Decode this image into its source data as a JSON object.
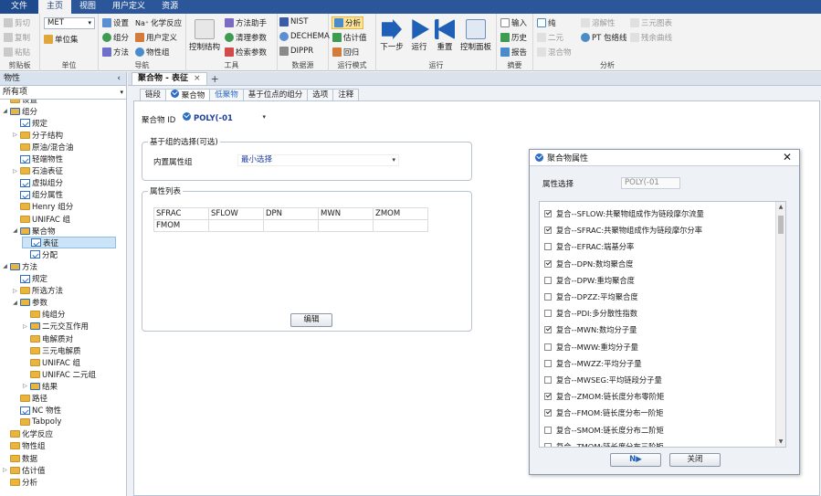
{
  "menu": {
    "file": "文件",
    "tabs": [
      "主页",
      "视图",
      "用户定义",
      "资源"
    ]
  },
  "ribbon": {
    "clipboard": {
      "label": "剪贴板",
      "cut": "剪切",
      "copy": "复制",
      "paste": "粘贴"
    },
    "unit": {
      "label": "单位",
      "set": "MET",
      "unitset": "单位集"
    },
    "nav": {
      "label": "导航",
      "settings": "设置",
      "components": "组分",
      "methods": "方法",
      "chem": "化学反应",
      "custom": "用户定义",
      "property_group": "物性组"
    },
    "tools": {
      "label": "工具",
      "control": "控制结构",
      "method_assist": "方法助手",
      "clean": "清理参数",
      "check": "检索参数"
    },
    "datasource": {
      "label": "数据源",
      "nist": "NIST",
      "dechema": "DECHEMA",
      "dippr": "DIPPR"
    },
    "runmode": {
      "label": "运行模式",
      "analysis": "分析",
      "estimate": "估计值",
      "regress": "回归"
    },
    "run": {
      "label": "运行",
      "next": "下一步",
      "run": "运行",
      "reset": "重置",
      "panel": "控制面板"
    },
    "summary": {
      "label": "摘要",
      "input": "输入",
      "history": "历史",
      "report": "报告"
    },
    "analysis": {
      "label": "分析",
      "pure": "纯",
      "binary": "二元",
      "mixture": "混合物",
      "residue": "溶解性",
      "pt": "PT 包络线",
      "ternary": "三元图表",
      "precip": "残余曲线"
    }
  },
  "left": {
    "title": "物性",
    "filter": "所有项",
    "tree": [
      {
        "label": "设置",
        "indent": 0,
        "icon": "folder",
        "exp": ""
      },
      {
        "label": "组分",
        "indent": 0,
        "icon": "folderb",
        "exp": "◢"
      },
      {
        "label": "规定",
        "indent": 1,
        "icon": "check",
        "exp": ""
      },
      {
        "label": "分子结构",
        "indent": 1,
        "icon": "folder",
        "exp": "▷"
      },
      {
        "label": "原油/混合油",
        "indent": 1,
        "icon": "folder",
        "exp": ""
      },
      {
        "label": "轻端物性",
        "indent": 1,
        "icon": "check",
        "exp": ""
      },
      {
        "label": "石油表征",
        "indent": 1,
        "icon": "folder",
        "exp": "▷"
      },
      {
        "label": "虚拟组分",
        "indent": 1,
        "icon": "check",
        "exp": ""
      },
      {
        "label": "组分属性",
        "indent": 1,
        "icon": "check",
        "exp": ""
      },
      {
        "label": "Henry 组分",
        "indent": 1,
        "icon": "folder",
        "exp": ""
      },
      {
        "label": "UNIFAC 组",
        "indent": 1,
        "icon": "folder",
        "exp": ""
      },
      {
        "label": "聚合物",
        "indent": 1,
        "icon": "folderb",
        "exp": "◢"
      },
      {
        "label": "表征",
        "indent": 2,
        "icon": "check",
        "exp": "",
        "sel": true
      },
      {
        "label": "分配",
        "indent": 2,
        "icon": "check",
        "exp": ""
      },
      {
        "label": "方法",
        "indent": 0,
        "icon": "folderb",
        "exp": "◢"
      },
      {
        "label": "规定",
        "indent": 1,
        "icon": "check",
        "exp": ""
      },
      {
        "label": "所选方法",
        "indent": 1,
        "icon": "folder",
        "exp": "▷"
      },
      {
        "label": "参数",
        "indent": 1,
        "icon": "folderb",
        "exp": "◢"
      },
      {
        "label": "纯组分",
        "indent": 2,
        "icon": "folder",
        "exp": ""
      },
      {
        "label": "二元交互作用",
        "indent": 2,
        "icon": "folderb",
        "exp": "▷"
      },
      {
        "label": "电解质对",
        "indent": 2,
        "icon": "folder",
        "exp": ""
      },
      {
        "label": "三元电解质",
        "indent": 2,
        "icon": "folder",
        "exp": ""
      },
      {
        "label": "UNIFAC 组",
        "indent": 2,
        "icon": "folder",
        "exp": ""
      },
      {
        "label": "UNIFAC 二元组",
        "indent": 2,
        "icon": "folder",
        "exp": ""
      },
      {
        "label": "结果",
        "indent": 2,
        "icon": "folderb",
        "exp": "▷"
      },
      {
        "label": "路径",
        "indent": 1,
        "icon": "folder",
        "exp": ""
      },
      {
        "label": "NC 物性",
        "indent": 1,
        "icon": "check",
        "exp": ""
      },
      {
        "label": "Tabpoly",
        "indent": 1,
        "icon": "folder",
        "exp": ""
      },
      {
        "label": "化学反应",
        "indent": 0,
        "icon": "folder",
        "exp": ""
      },
      {
        "label": "物性组",
        "indent": 0,
        "icon": "folder",
        "exp": ""
      },
      {
        "label": "数据",
        "indent": 0,
        "icon": "folder",
        "exp": ""
      },
      {
        "label": "估计值",
        "indent": 0,
        "icon": "folder",
        "exp": "▷"
      },
      {
        "label": "分析",
        "indent": 0,
        "icon": "folder",
        "exp": ""
      }
    ]
  },
  "doc": {
    "tab": "聚合物 - 表征",
    "close": "×",
    "plus": "+",
    "subtabs": [
      "链段",
      "聚合物",
      "低聚物",
      "基于位点的组分",
      "选项",
      "注释"
    ],
    "polymer_id_label": "聚合物 ID",
    "polymer_id": "POLY(-01",
    "group_legend": "基于组的选择(可选)",
    "builtin_label": "内置属性组",
    "builtin_value": "最小选择",
    "list_legend": "属性列表",
    "table": [
      [
        "SFRAC",
        "SFLOW",
        "DPN",
        "MWN",
        "ZMOM"
      ],
      [
        "FMOM",
        "",
        "",
        "",
        ""
      ]
    ],
    "edit": "编辑"
  },
  "dialog": {
    "title": "聚合物属性",
    "sel_label": "属性选择",
    "sel_value": "POLY(-01",
    "ok": "N▶",
    "close": "关闭",
    "items": [
      {
        "text": "复合--SFLOW:共聚物组成作为链段摩尔流量",
        "on": true
      },
      {
        "text": "复合--SFRAC:共聚物组成作为链段摩尔分率",
        "on": true
      },
      {
        "text": "复合--EFRAC:端基分率",
        "on": false
      },
      {
        "text": "复合--DPN:数均聚合度",
        "on": true
      },
      {
        "text": "复合--DPW:重均聚合度",
        "on": false
      },
      {
        "text": "复合--DPZZ:平均聚合度",
        "on": false
      },
      {
        "text": "复合--PDI:多分散性指数",
        "on": false
      },
      {
        "text": "复合--MWN:数均分子量",
        "on": true
      },
      {
        "text": "复合--MWW:重均分子量",
        "on": false
      },
      {
        "text": "复合--MWZZ:平均分子量",
        "on": false
      },
      {
        "text": "复合--MWSEG:平均链段分子量",
        "on": false
      },
      {
        "text": "复合--ZMOM:链长度分布零阶矩",
        "on": true
      },
      {
        "text": "复合--FMOM:链长度分布一阶矩",
        "on": true
      },
      {
        "text": "复合--SMOM:链长度分布二阶矩",
        "on": false
      },
      {
        "text": "复合--TMOM:链长度分布三阶矩",
        "on": false
      }
    ]
  },
  "colors": {
    "accent": "#2b579a",
    "folder": "#e9b53e",
    "check": "#2b6cc4"
  }
}
